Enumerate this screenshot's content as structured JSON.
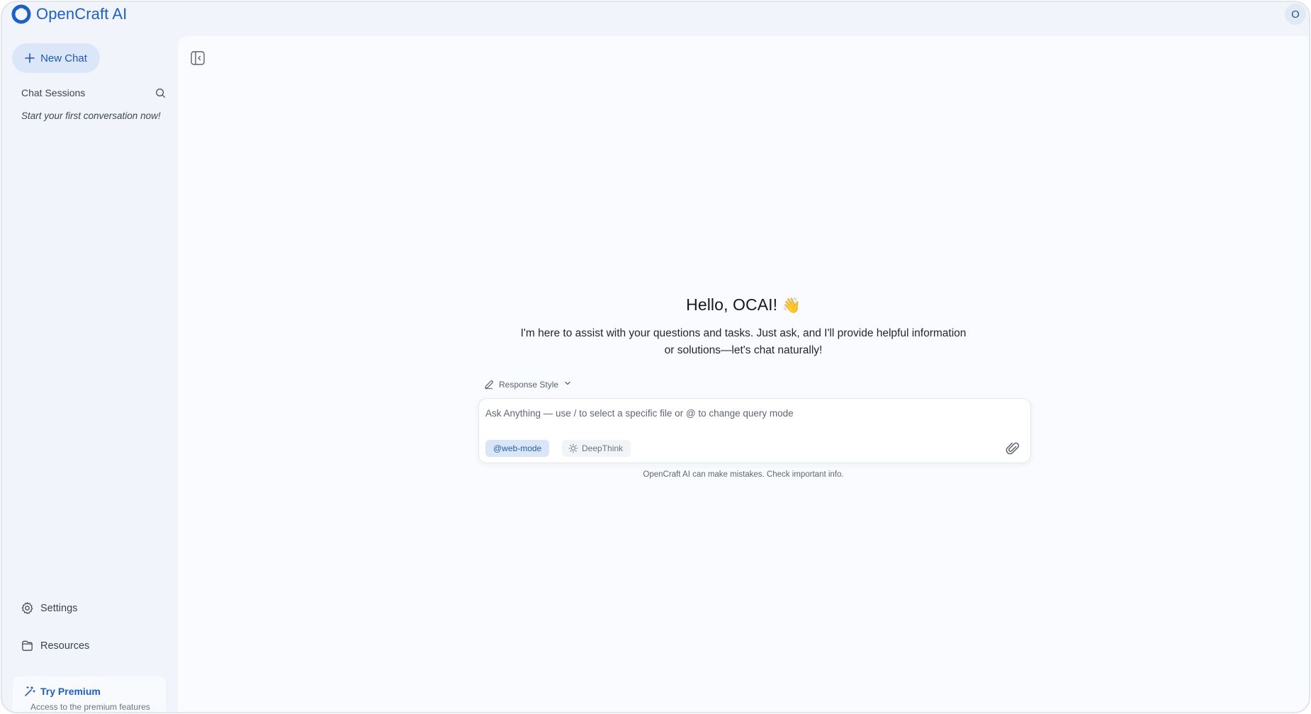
{
  "app": {
    "name": "OpenCraft AI",
    "avatar_initial": "O"
  },
  "sidebar": {
    "new_chat_label": "New Chat",
    "sessions_title": "Chat Sessions",
    "empty_note": "Start your first conversation now!",
    "settings_label": "Settings",
    "resources_label": "Resources",
    "premium_title": "Try Premium",
    "premium_subtitle": "Access to the premium features"
  },
  "main": {
    "greeting": "Hello, OCAI!",
    "greeting_emoji": "👋",
    "intro_line1": "I'm here to assist with your questions and tasks. Just ask, and I'll provide helpful information",
    "intro_line2": "or solutions—let's chat naturally!",
    "response_style_label": "Response Style",
    "composer_placeholder": "Ask Anything — use / to select a specific file or @ to change query mode",
    "chip_web": "@web-mode",
    "chip_think": "DeepThink",
    "disclaimer": "OpenCraft AI can make mistakes. Check important info."
  },
  "icons": {
    "logo": "opencraft-logo",
    "plus": "plus-icon",
    "search": "search-icon",
    "settings": "gear-icon",
    "resources": "folder-icon",
    "premium": "magic-wand-icon",
    "collapse": "sidebar-collapse-icon",
    "pencil": "pencil-icon",
    "chevron": "chevron-down-icon",
    "bulb": "lightbulb-icon",
    "attach": "paperclip-icon"
  },
  "colors": {
    "brand": "#1f5fc4",
    "sidebar_bg": "#f1f5fb",
    "main_bg": "#f9fbfe",
    "chip_active_bg": "#d9e6f8"
  }
}
